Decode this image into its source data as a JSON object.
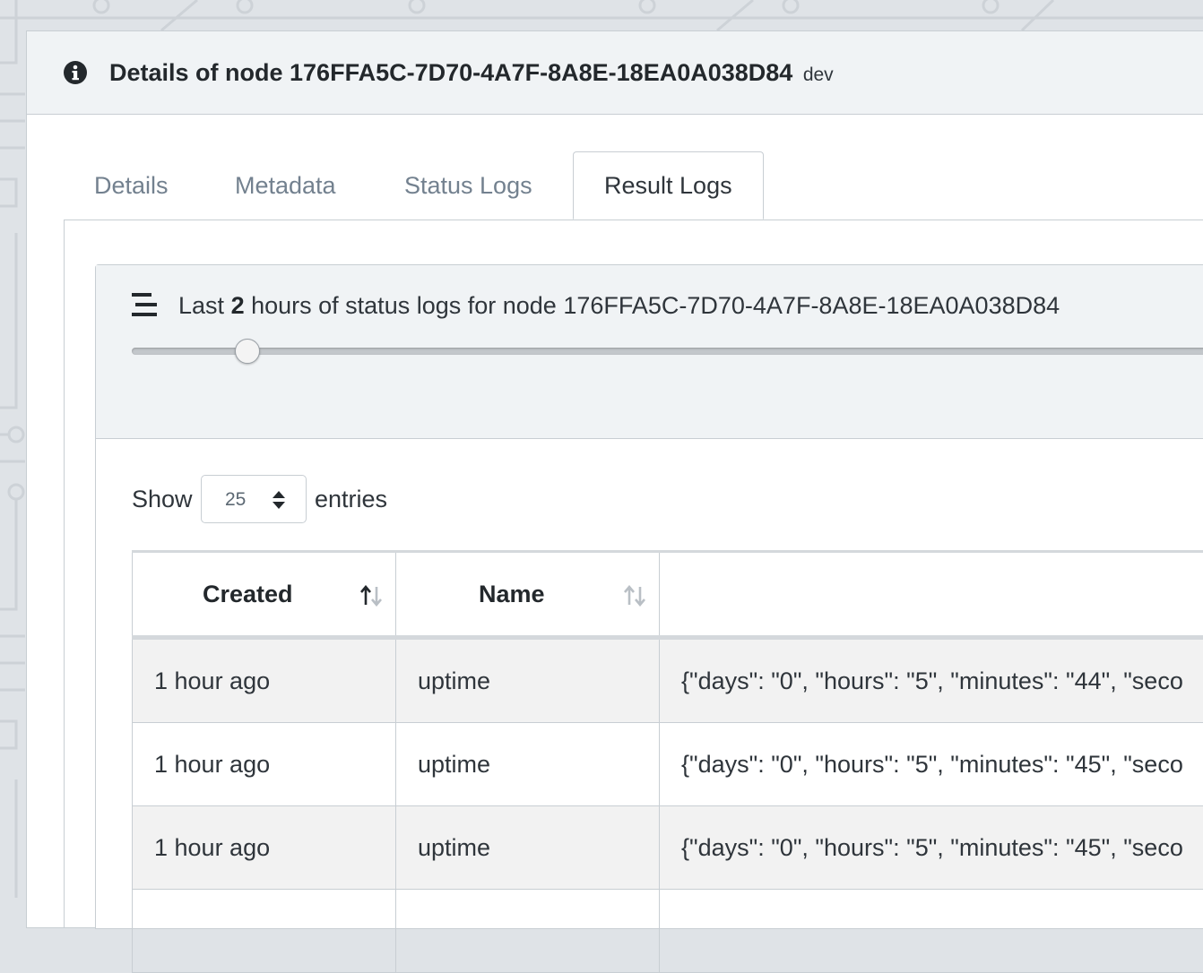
{
  "header": {
    "title": "Details of node 176FFA5C-7D70-4A7F-8A8E-18EA0A038D84",
    "environment": "dev",
    "icon": "info-circle-icon"
  },
  "tabs": [
    {
      "label": "Details",
      "active": false
    },
    {
      "label": "Metadata",
      "active": false
    },
    {
      "label": "Status Logs",
      "active": false
    },
    {
      "label": "Result Logs",
      "active": true
    }
  ],
  "logs_panel": {
    "icon": "menu-icon",
    "title_prefix": "Last",
    "hours": "2",
    "title_suffix": "hours of status logs for node 176FFA5C-7D70-4A7F-8A8E-18EA0A038D84",
    "slider_value_fraction": 0.105
  },
  "pagination": {
    "show_label": "Show",
    "page_size": "25",
    "entries_label": "entries"
  },
  "table": {
    "columns": [
      "Created",
      "Name",
      ""
    ],
    "sort": {
      "created": "ascending",
      "name": "none"
    },
    "rows": [
      [
        "1 hour ago",
        "uptime",
        "{\"days\": \"0\", \"hours\": \"5\", \"minutes\": \"44\", \"seco"
      ],
      [
        "1 hour ago",
        "uptime",
        "{\"days\": \"0\", \"hours\": \"5\", \"minutes\": \"45\", \"seco"
      ],
      [
        "1 hour ago",
        "uptime",
        "{\"days\": \"0\", \"hours\": \"5\", \"minutes\": \"45\", \"seco"
      ]
    ]
  },
  "colors": {
    "page_background": "#dfe3e7",
    "header_background": "#f0f3f5",
    "border": "#c8ced3",
    "striped_row": "#f2f2f2"
  }
}
